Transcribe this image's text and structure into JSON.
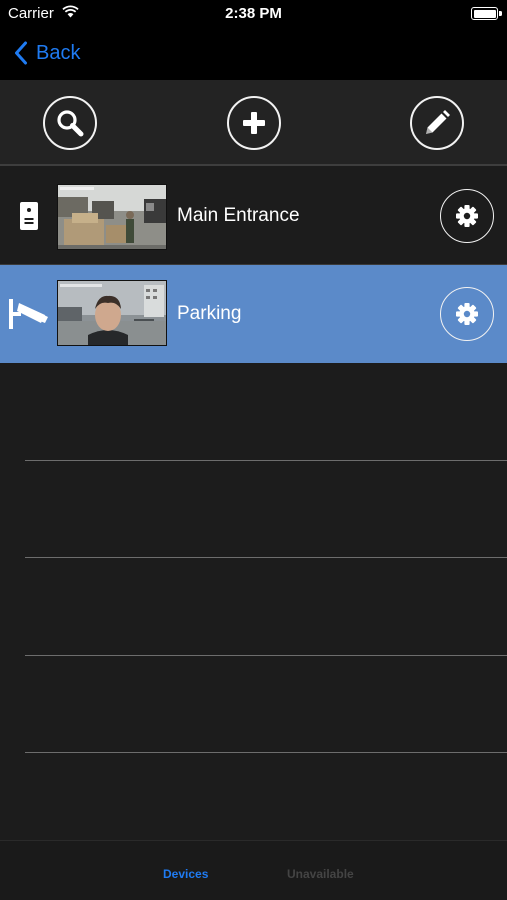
{
  "status_bar": {
    "carrier": "Carrier",
    "time": "2:38 PM"
  },
  "nav": {
    "back_label": "Back"
  },
  "toolbar": {
    "search_icon": "magnifier-icon",
    "add_icon": "plus-icon",
    "edit_icon": "pencil-icon"
  },
  "devices": [
    {
      "name": "Main Entrance",
      "type_icon": "door-intercom-icon",
      "selected": false
    },
    {
      "name": "Parking",
      "type_icon": "security-camera-icon",
      "selected": true
    }
  ],
  "tabs": [
    {
      "label": "Devices",
      "active": true
    },
    {
      "label": "Unavailable",
      "active": false
    }
  ],
  "colors": {
    "accent": "#1f7bf2",
    "selected_row": "#5b8ac9",
    "background": "#1c1c1c",
    "nav_background": "#000000",
    "tab_inactive": "#444444"
  }
}
